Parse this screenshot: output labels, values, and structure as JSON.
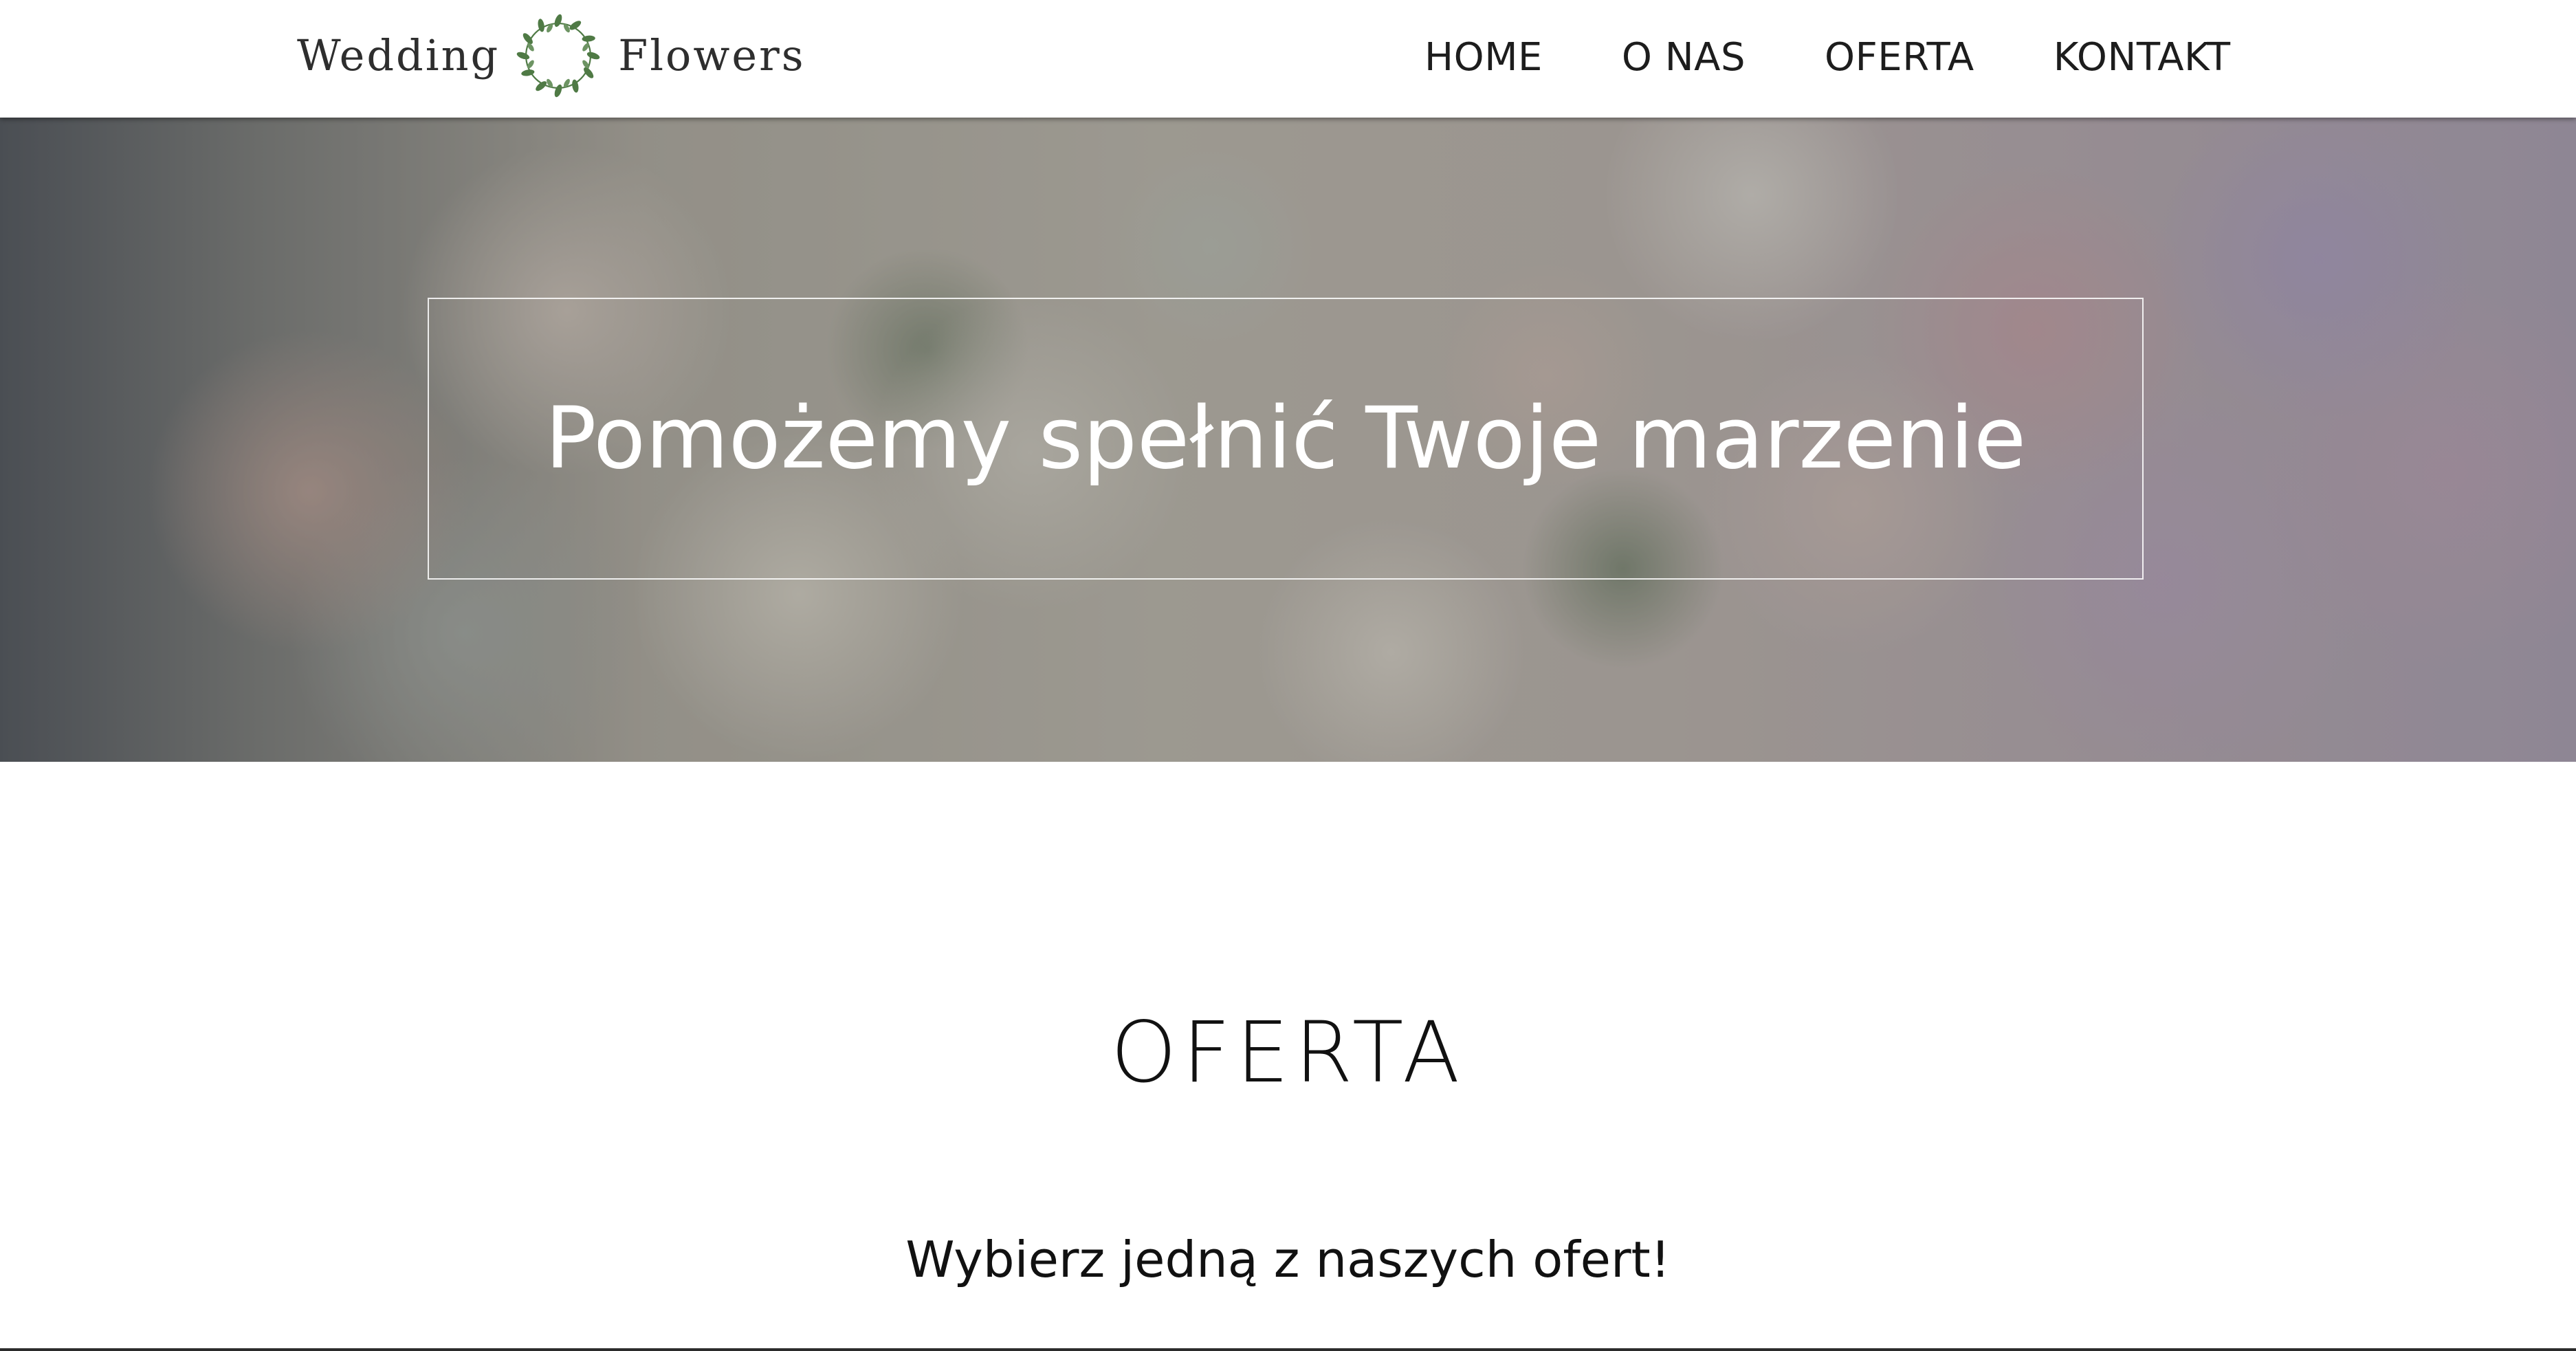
{
  "header": {
    "logo": {
      "word_left": "Wedding",
      "word_right": "Flowers",
      "icon": "wreath-icon",
      "accent_color": "#4f7a45"
    },
    "nav": [
      {
        "label": "HOME"
      },
      {
        "label": "O NAS"
      },
      {
        "label": "OFERTA"
      },
      {
        "label": "KONTAKT"
      }
    ]
  },
  "hero": {
    "title": "Pomożemy spełnić Twoje marzenie"
  },
  "offer": {
    "title": "OFERTA",
    "subtitle": "Wybierz jedną z naszych ofert!"
  },
  "colors": {
    "text": "#111111",
    "header_bg": "#ffffff",
    "hero_text": "#ffffff"
  }
}
